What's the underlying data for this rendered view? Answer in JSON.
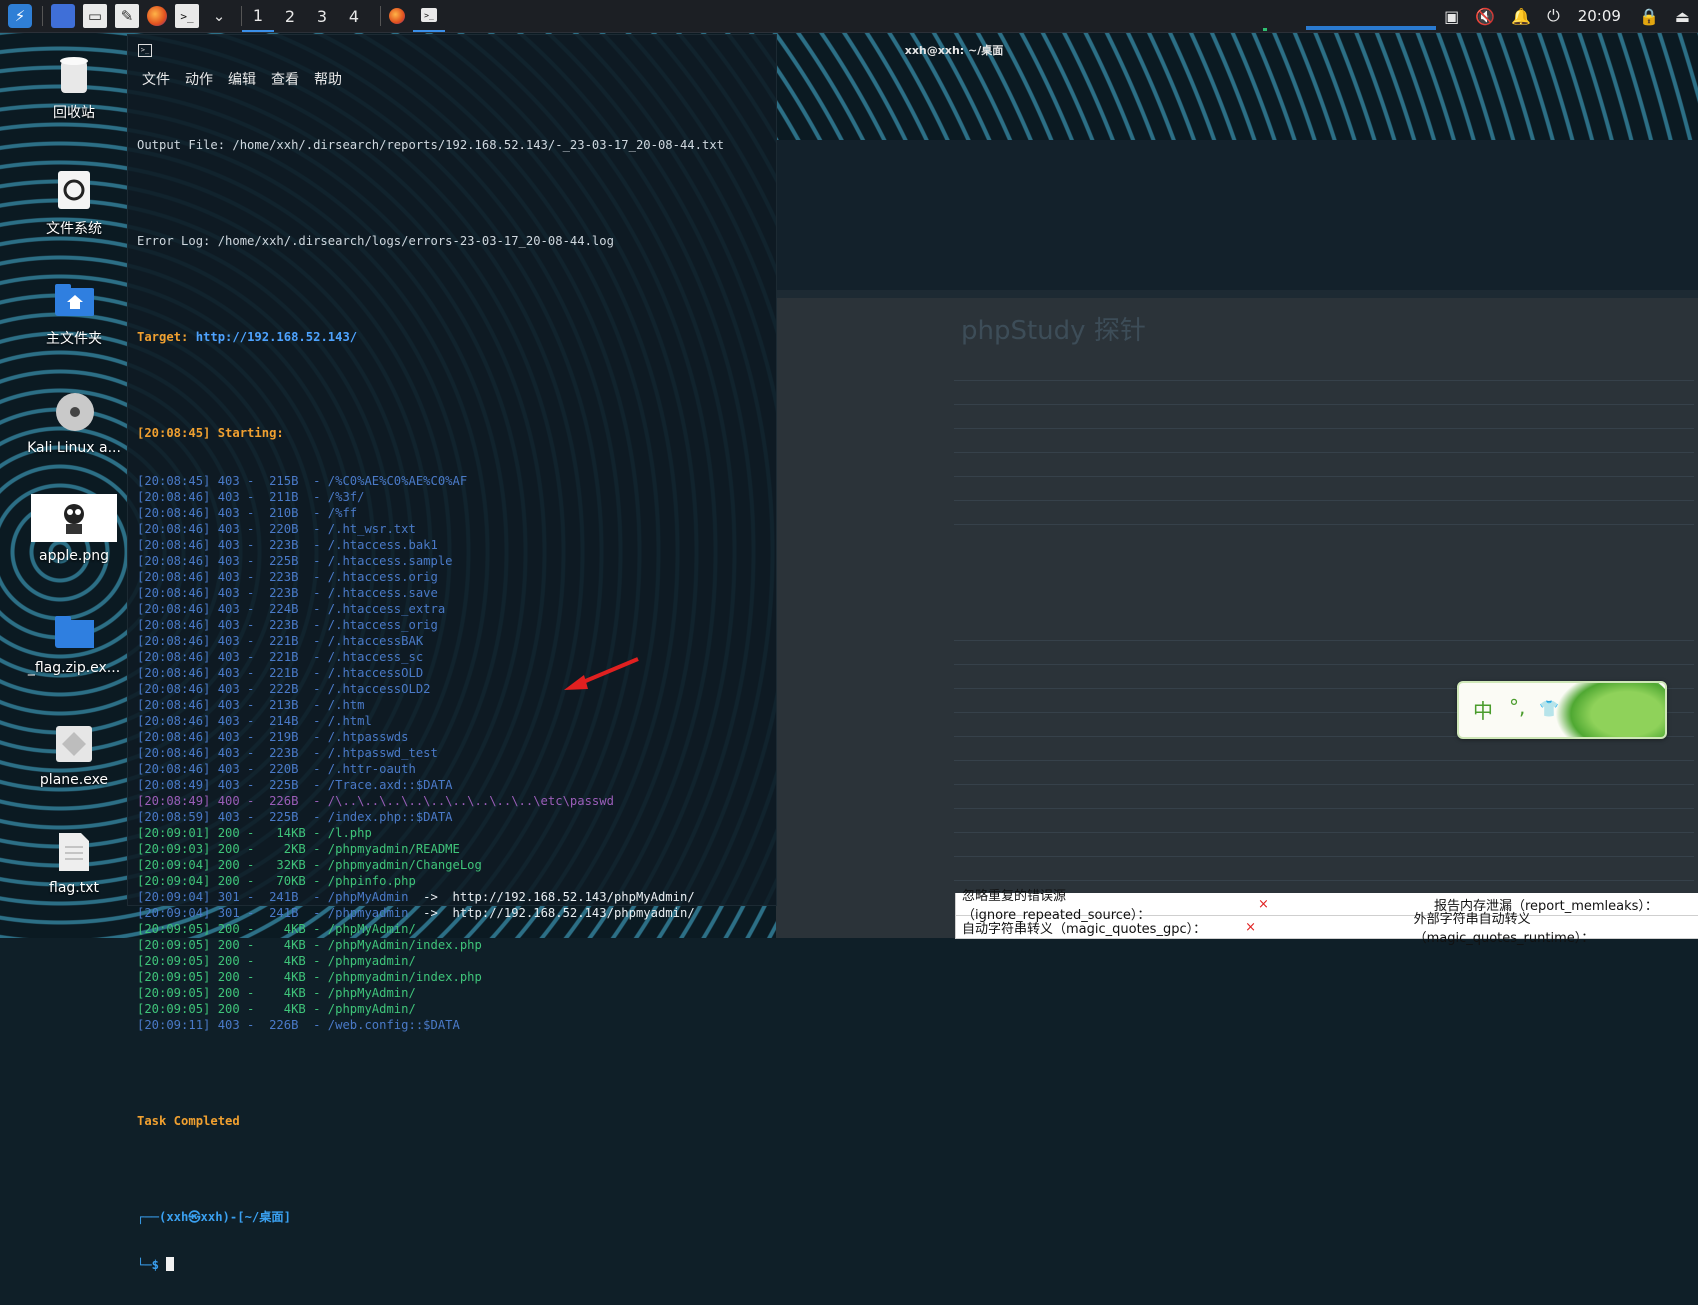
{
  "panel": {
    "workspaces": [
      "1",
      "2",
      "3",
      "4"
    ],
    "active_workspace": "1",
    "clock": "20:09",
    "icons": [
      "kali-menu-icon",
      "show-desktop-icon",
      "file-manager-icon",
      "text-editor-icon",
      "firefox-icon",
      "terminal-icon",
      "chevron-down-icon",
      "firefox-task-icon",
      "terminal-task-icon",
      "screen-icon",
      "mute-icon",
      "bell-icon",
      "power-icon",
      "lock-icon",
      "logout-icon"
    ]
  },
  "desktop_icons": [
    {
      "label": "回收站",
      "icon": "trash-icon"
    },
    {
      "label": "文件系统",
      "icon": "filesystem-icon"
    },
    {
      "label": "主文件夹",
      "icon": "home-folder-icon"
    },
    {
      "label": "Kali Linux a...",
      "icon": "disc-icon"
    },
    {
      "label": "apple.png",
      "icon": "image-thumbnail-icon"
    },
    {
      "label": "_flag.zip.ex...",
      "icon": "folder-icon"
    },
    {
      "label": "plane.exe",
      "icon": "exe-icon"
    },
    {
      "label": "flag.txt",
      "icon": "text-file-icon"
    }
  ],
  "terminal": {
    "title": "xxh@xxh: ~/桌面",
    "menu": [
      "文件",
      "动作",
      "编辑",
      "查看",
      "帮助"
    ],
    "output_file": "Output File: /home/xxh/.dirsearch/reports/192.168.52.143/-_23-03-17_20-08-44.txt",
    "error_log": "Error Log: /home/xxh/.dirsearch/logs/errors-23-03-17_20-08-44.log",
    "target_label": "Target: ",
    "target_url": "http://192.168.52.143/",
    "starting": "[20:08:45] Starting:",
    "lines": [
      {
        "text": "[20:08:45] 403 -  215B  - /%C0%AE%C0%AE%C0%AF",
        "color": "blue"
      },
      {
        "text": "[20:08:46] 403 -  211B  - /%3f/",
        "color": "blue"
      },
      {
        "text": "[20:08:46] 403 -  210B  - /%ff",
        "color": "blue"
      },
      {
        "text": "[20:08:46] 403 -  220B  - /.ht_wsr.txt",
        "color": "blue"
      },
      {
        "text": "[20:08:46] 403 -  223B  - /.htaccess.bak1",
        "color": "blue"
      },
      {
        "text": "[20:08:46] 403 -  225B  - /.htaccess.sample",
        "color": "blue"
      },
      {
        "text": "[20:08:46] 403 -  223B  - /.htaccess.orig",
        "color": "blue"
      },
      {
        "text": "[20:08:46] 403 -  223B  - /.htaccess.save",
        "color": "blue"
      },
      {
        "text": "[20:08:46] 403 -  224B  - /.htaccess_extra",
        "color": "blue"
      },
      {
        "text": "[20:08:46] 403 -  223B  - /.htaccess_orig",
        "color": "blue"
      },
      {
        "text": "[20:08:46] 403 -  221B  - /.htaccessBAK",
        "color": "blue"
      },
      {
        "text": "[20:08:46] 403 -  221B  - /.htaccess_sc",
        "color": "blue"
      },
      {
        "text": "[20:08:46] 403 -  221B  - /.htaccessOLD",
        "color": "blue"
      },
      {
        "text": "[20:08:46] 403 -  222B  - /.htaccessOLD2",
        "color": "blue"
      },
      {
        "text": "[20:08:46] 403 -  213B  - /.htm",
        "color": "blue"
      },
      {
        "text": "[20:08:46] 403 -  214B  - /.html",
        "color": "blue"
      },
      {
        "text": "[20:08:46] 403 -  219B  - /.htpasswds",
        "color": "blue"
      },
      {
        "text": "[20:08:46] 403 -  223B  - /.htpasswd_test",
        "color": "blue"
      },
      {
        "text": "[20:08:46] 403 -  220B  - /.httr-oauth",
        "color": "blue"
      },
      {
        "text": "[20:08:49] 403 -  225B  - /Trace.axd::$DATA",
        "color": "blue"
      },
      {
        "text": "[20:08:49] 400 -  226B  - /\\..\\..\\..\\..\\..\\..\\..\\..\\..\\etc\\passwd",
        "color": "purple"
      },
      {
        "text": "[20:08:59] 403 -  225B  - /index.php::$DATA",
        "color": "blue"
      },
      {
        "text": "[20:09:01] 200 -   14KB - /l.php",
        "color": "green"
      },
      {
        "text": "[20:09:03] 200 -    2KB - /phpmyadmin/README",
        "color": "green"
      },
      {
        "text": "[20:09:04] 200 -   32KB - /phpmyadmin/ChangeLog",
        "color": "green"
      },
      {
        "text": "[20:09:04] 200 -   70KB - /phpinfo.php",
        "color": "green"
      },
      {
        "text": "[20:09:04] 301 -  241B  - /phpMyAdmin  ",
        "redirect": "->  http://192.168.52.143/phpMyAdmin/",
        "color": "blue"
      },
      {
        "text": "[20:09:04] 301 -  241B  - /phpmyadmin  ",
        "redirect": "->  http://192.168.52.143/phpmyadmin/",
        "color": "blue"
      },
      {
        "text": "[20:09:05] 200 -    4KB - /phpMyAdmin/",
        "color": "green"
      },
      {
        "text": "[20:09:05] 200 -    4KB - /phpMyAdmin/index.php",
        "color": "green"
      },
      {
        "text": "[20:09:05] 200 -    4KB - /phpmyadmin/",
        "color": "green"
      },
      {
        "text": "[20:09:05] 200 -    4KB - /phpmyadmin/index.php",
        "color": "green"
      },
      {
        "text": "[20:09:05] 200 -    4KB - /phpMyAdmin/",
        "color": "green"
      },
      {
        "text": "[20:09:05] 200 -    4KB - /phpmyAdmin/",
        "color": "green"
      },
      {
        "text": "[20:09:11] 403 -  226B  - /web.config::$DATA",
        "color": "blue"
      }
    ],
    "completed": "Task Completed",
    "prompt_top": "┌──(xxh㉿xxh)-[~/桌面]",
    "prompt_bottom": "└─$ "
  },
  "browser": {
    "page_title": "phpStudy 探针",
    "bottom_rows": [
      {
        "label": "忽略重复的错误源（ignore_repeated_source）：",
        "value": "×",
        "right": "报告内存泄漏（report_memleaks）："
      },
      {
        "label": "自动字符串转义（magic_quotes_gpc）：",
        "value": "×",
        "right": "外部字符串自动转义（magic_quotes_runtime）："
      }
    ]
  },
  "ime": {
    "chars": [
      "中",
      "°,",
      "👕"
    ]
  },
  "colors": {
    "accent": "#3b8fe8",
    "orange": "#f0a030",
    "cyan": "#4ea3ff",
    "blue_line": "#4a7ac8",
    "green_line": "#3fc47a",
    "purple_line": "#9a5db8",
    "arrow": "#e02020"
  }
}
